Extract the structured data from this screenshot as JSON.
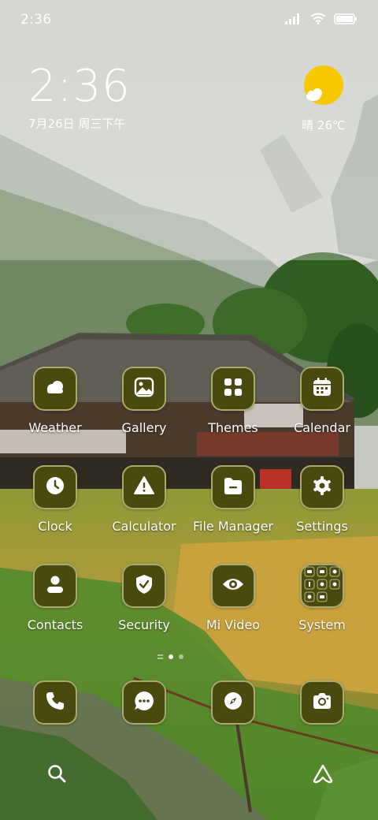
{
  "status_bar": {
    "time": "2:36",
    "icons": [
      "cellular-signal-icon",
      "wifi-icon",
      "battery-icon"
    ]
  },
  "clock_widget": {
    "time": "2:36",
    "date": "7月26日 周三下午"
  },
  "weather_widget": {
    "icon": "sun-cloud-icon",
    "text": "晴 26℃"
  },
  "apps": [
    {
      "label": "Weather",
      "icon": "cloud-icon"
    },
    {
      "label": "Gallery",
      "icon": "image-icon"
    },
    {
      "label": "Themes",
      "icon": "grid-icon"
    },
    {
      "label": "Calendar",
      "icon": "calendar-icon"
    },
    {
      "label": "Clock",
      "icon": "clock-icon"
    },
    {
      "label": "Calculator",
      "icon": "warning-icon"
    },
    {
      "label": "File Manager",
      "icon": "folder-icon"
    },
    {
      "label": "Settings",
      "icon": "gear-icon"
    },
    {
      "label": "Contacts",
      "icon": "person-icon"
    },
    {
      "label": "Security",
      "icon": "shield-check-icon"
    },
    {
      "label": "Mi Video",
      "icon": "eye-icon"
    },
    {
      "label": "System",
      "icon": "folder-grid-icon"
    }
  ],
  "page_indicator": {
    "pages": 3,
    "active": 2
  },
  "dock": [
    {
      "icon": "phone-icon"
    },
    {
      "icon": "message-icon"
    },
    {
      "icon": "compass-icon"
    },
    {
      "icon": "camera-icon"
    }
  ],
  "bottom_bar": [
    {
      "icon": "search-icon"
    },
    {
      "icon": "app-vault-icon"
    }
  ],
  "colors": {
    "icon_background": "#4a4a10",
    "icon_border": "#afaf73",
    "weather_sun": "#f7c800"
  }
}
